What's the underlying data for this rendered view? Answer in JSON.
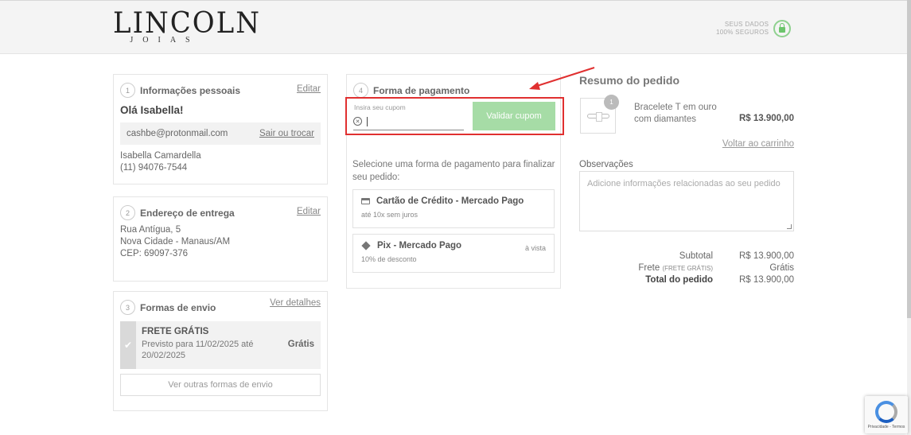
{
  "header": {
    "logo_main": "LINCOLN",
    "logo_sub": "JOIAS",
    "secure_line1": "SEUS DADOS",
    "secure_line2": "100% SEGUROS",
    "icon": "lock-icon"
  },
  "personal": {
    "step": "1",
    "title": "Informações pessoais",
    "edit": "Editar",
    "greeting": "Olá Isabella!",
    "email": "cashbe@protonmail.com",
    "switch_link": "Sair ou trocar",
    "name": "Isabella Camardella",
    "phone": "(11) 94076-7544"
  },
  "address": {
    "step": "2",
    "title": "Endereço de entrega",
    "edit": "Editar",
    "line1": "Rua Antígua, 5",
    "line2": "Nova Cidade - Manaus/AM",
    "line3": "CEP: 69097-376"
  },
  "shipping": {
    "step": "3",
    "title": "Formas de envio",
    "details_link": "Ver detalhes",
    "option_title": "FRETE GRÁTIS",
    "option_date": "Previsto para 11/02/2025 até 20/02/2025",
    "option_price": "Grátis",
    "other_options": "Ver outras formas de envio"
  },
  "payment": {
    "step": "4",
    "title": "Forma de pagamento",
    "coupon_label": "Insira seu cupom",
    "coupon_button": "Validar cupom",
    "intro": "Selecione uma forma de pagamento para finalizar seu pedido:",
    "options": [
      {
        "title": "Cartão de Crédito - Mercado Pago",
        "subtitle": "até 10x sem juros",
        "right": "",
        "icon": "credit-card-icon"
      },
      {
        "title": "Pix - Mercado Pago",
        "subtitle": "10% de desconto",
        "right": "à vista",
        "icon": "pix-icon"
      }
    ]
  },
  "summary": {
    "title": "Resumo do pedido",
    "product_qty": "1",
    "product_name": "Bracelete T em ouro com diamantes",
    "product_price": "R$ 13.900,00",
    "back_to_cart": "Voltar ao carrinho",
    "notes_label": "Observações",
    "notes_placeholder": "Adicione informações relacionadas ao seu pedido",
    "subtotal_label": "Subtotal",
    "subtotal_value": "R$ 13.900,00",
    "shipping_label": "Frete",
    "shipping_note": "(FRETE GRÁTIS)",
    "shipping_value": "Grátis",
    "total_label": "Total do pedido",
    "total_value": "R$ 13.900,00"
  },
  "recaptcha": {
    "text": "Privacidade - Termos"
  },
  "colors": {
    "annotation_red": "#e03030",
    "coupon_button_green": "#a6dca6",
    "secure_green": "#6cc46c"
  }
}
